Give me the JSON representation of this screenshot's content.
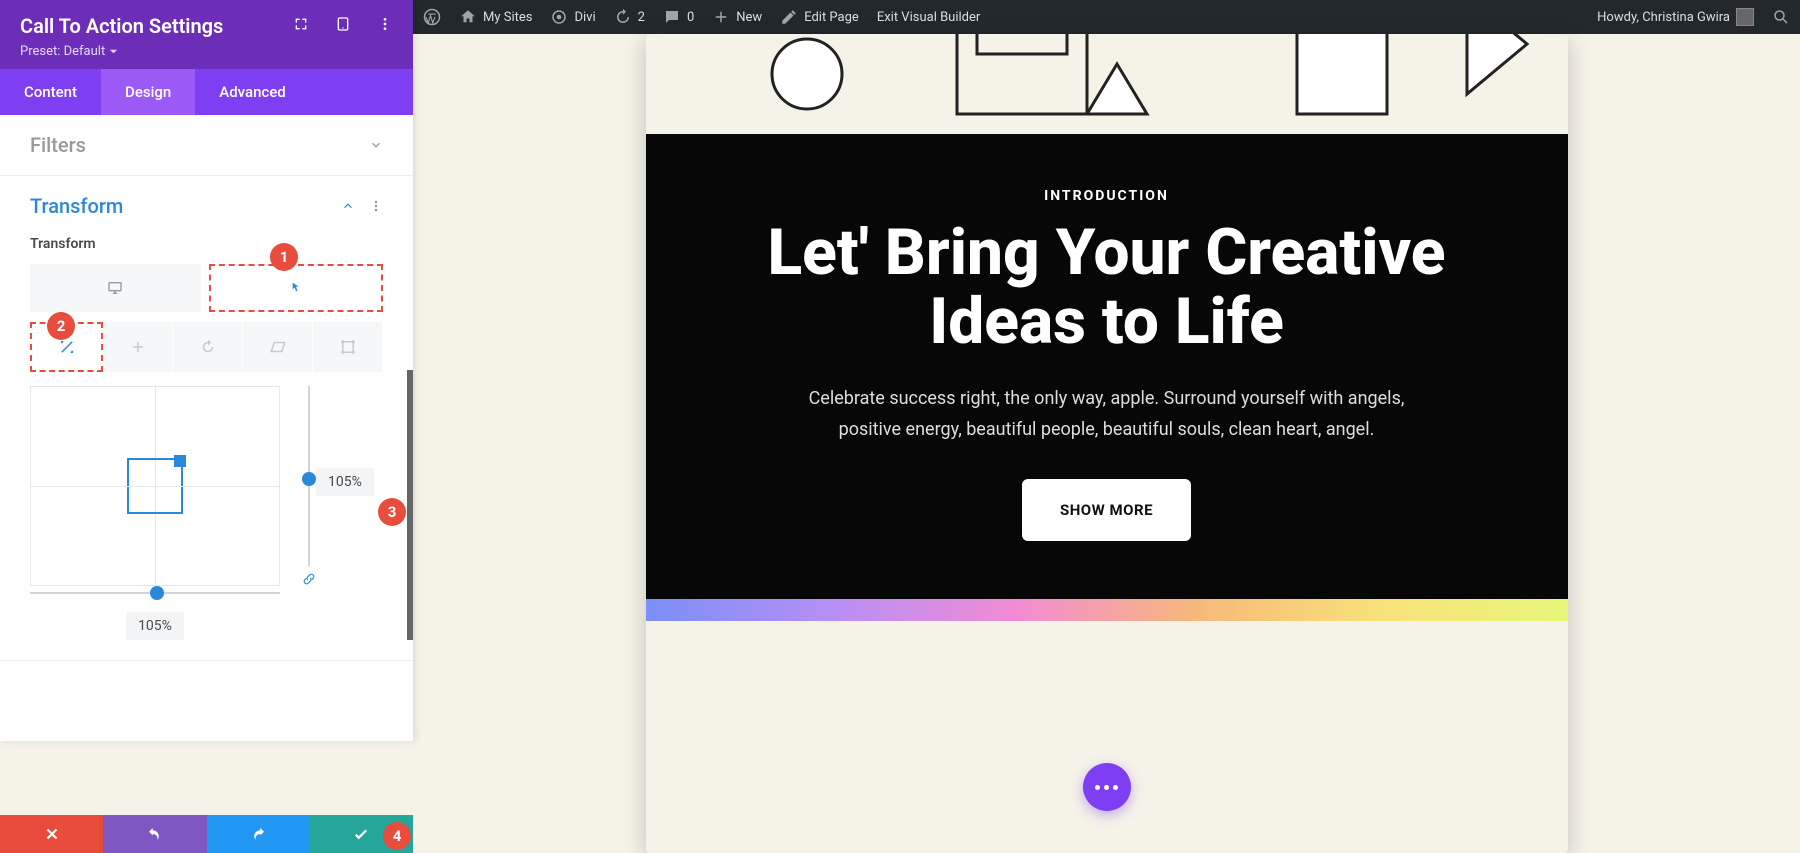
{
  "wp_bar": {
    "my_sites": "My Sites",
    "divi": "Divi",
    "updates": "2",
    "comments": "0",
    "new": "New",
    "edit_page": "Edit Page",
    "exit_vb": "Exit Visual Builder",
    "howdy": "Howdy, Christina Gwira"
  },
  "panel": {
    "title": "Call To Action Settings",
    "preset_label": "Preset: Default",
    "tabs": {
      "content": "Content",
      "design": "Design",
      "advanced": "Advanced"
    },
    "filters": "Filters",
    "transform": "Transform",
    "transform_label": "Transform",
    "scale_x": "105%",
    "scale_y": "105%"
  },
  "cta": {
    "eyebrow": "INTRODUCTION",
    "heading": "Let' Bring Your Creative Ideas to Life",
    "body": "Celebrate success right, the only way, apple. Surround yourself with angels, positive energy, beautiful people, beautiful souls, clean heart, angel.",
    "button": "SHOW MORE"
  },
  "callouts": {
    "c1": "1",
    "c2": "2",
    "c3": "3",
    "c4": "4"
  }
}
